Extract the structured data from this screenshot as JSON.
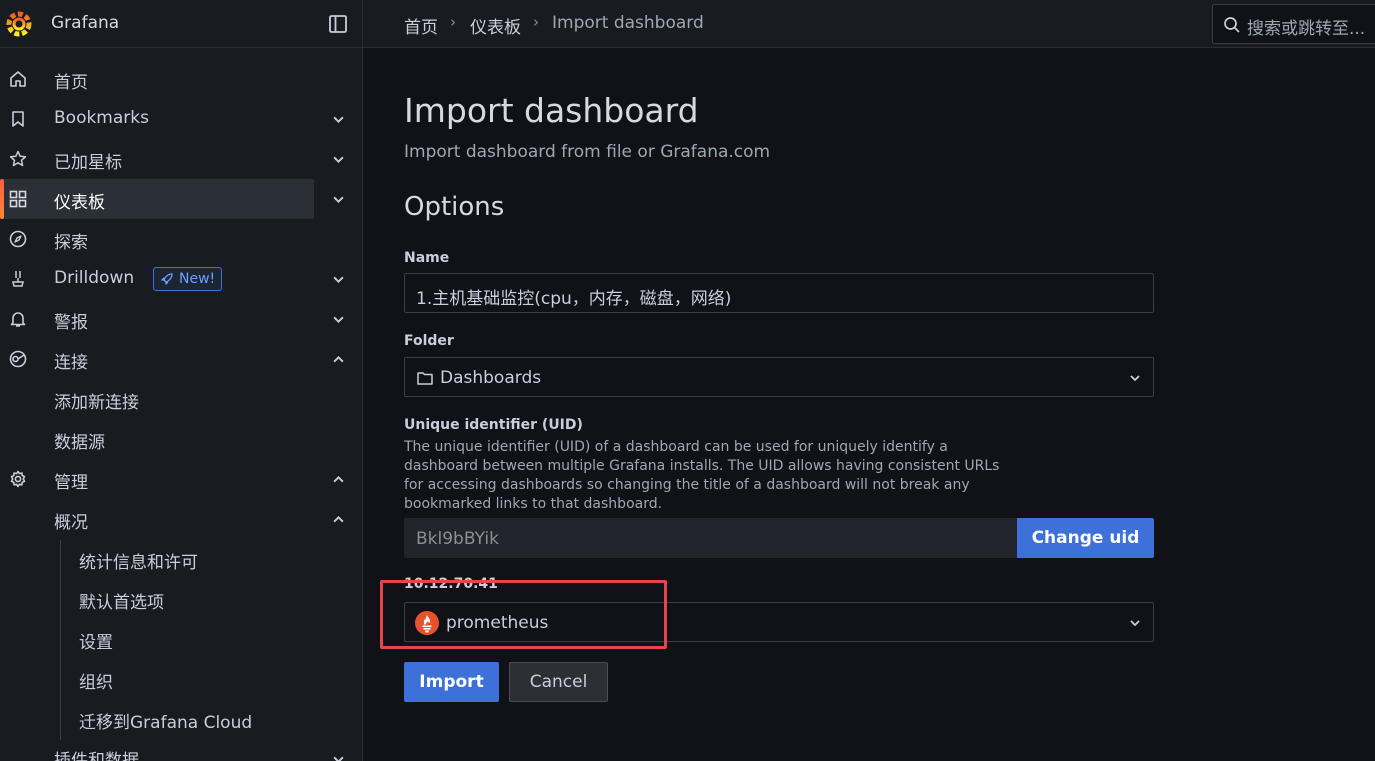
{
  "app": {
    "title": "Grafana"
  },
  "sidebar": {
    "items": [
      {
        "label": "首页",
        "icon": "home-icon"
      },
      {
        "label": "Bookmarks",
        "icon": "bookmark-icon"
      },
      {
        "label": "已加星标",
        "icon": "star-icon"
      },
      {
        "label": "仪表板",
        "icon": "apps-icon"
      },
      {
        "label": "探索",
        "icon": "compass-icon"
      },
      {
        "label": "Drilldown",
        "icon": "drilldown-icon",
        "badge": "New!"
      },
      {
        "label": "警报",
        "icon": "bell-icon"
      },
      {
        "label": "连接",
        "icon": "connections-icon"
      },
      {
        "label": "添加新连接"
      },
      {
        "label": "数据源"
      },
      {
        "label": "管理",
        "icon": "gear-icon"
      },
      {
        "label": "概况"
      },
      {
        "label": "统计信息和许可"
      },
      {
        "label": "默认首选项"
      },
      {
        "label": "设置"
      },
      {
        "label": "组织"
      },
      {
        "label": "迁移到Grafana Cloud"
      },
      {
        "label": "插件和数据"
      }
    ],
    "active_item": "仪表板"
  },
  "breadcrumb": {
    "home": "首页",
    "dashboards": "仪表板",
    "current": "Import dashboard"
  },
  "search": {
    "placeholder": "搜索或跳转至..."
  },
  "page": {
    "title": "Import dashboard",
    "subtitle": "Import dashboard from file or Grafana.com",
    "options_title": "Options",
    "name_label": "Name",
    "name_value": "1.主机基础监控(cpu，内存，磁盘，网络)",
    "folder_label": "Folder",
    "folder_value": "Dashboards",
    "uid_label": "Unique identifier (UID)",
    "uid_description": "The unique identifier (UID) of a dashboard can be used for uniquely identify a dashboard between multiple Grafana installs. The UID allows having consistent URLs for accessing dashboards so changing the title of a dashboard will not break any bookmarked links to that dashboard.",
    "uid_value": "Bkl9bBYik",
    "change_uid_label": "Change uid",
    "datasource_label": "10.12.70.41",
    "datasource_value": "prometheus",
    "import_label": "Import",
    "cancel_label": "Cancel"
  },
  "colors": {
    "accent": "#3d71d9",
    "highlight": "#e5454b",
    "brand": "#f46800"
  }
}
